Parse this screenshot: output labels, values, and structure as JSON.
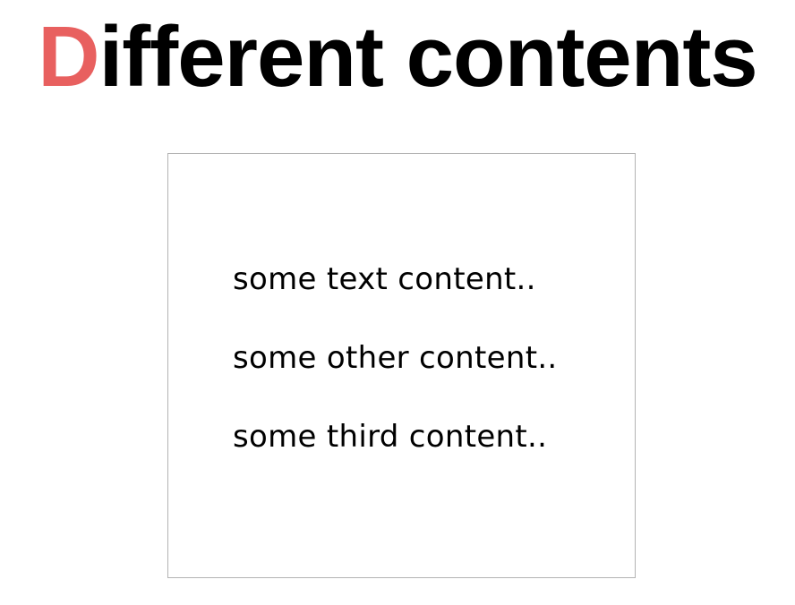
{
  "heading": {
    "first_letter": "D",
    "rest": "ifferent contents",
    "accent_color": "#e8605f"
  },
  "content_box": {
    "items": [
      "some text content..",
      "some other content..",
      "some third content.."
    ]
  }
}
